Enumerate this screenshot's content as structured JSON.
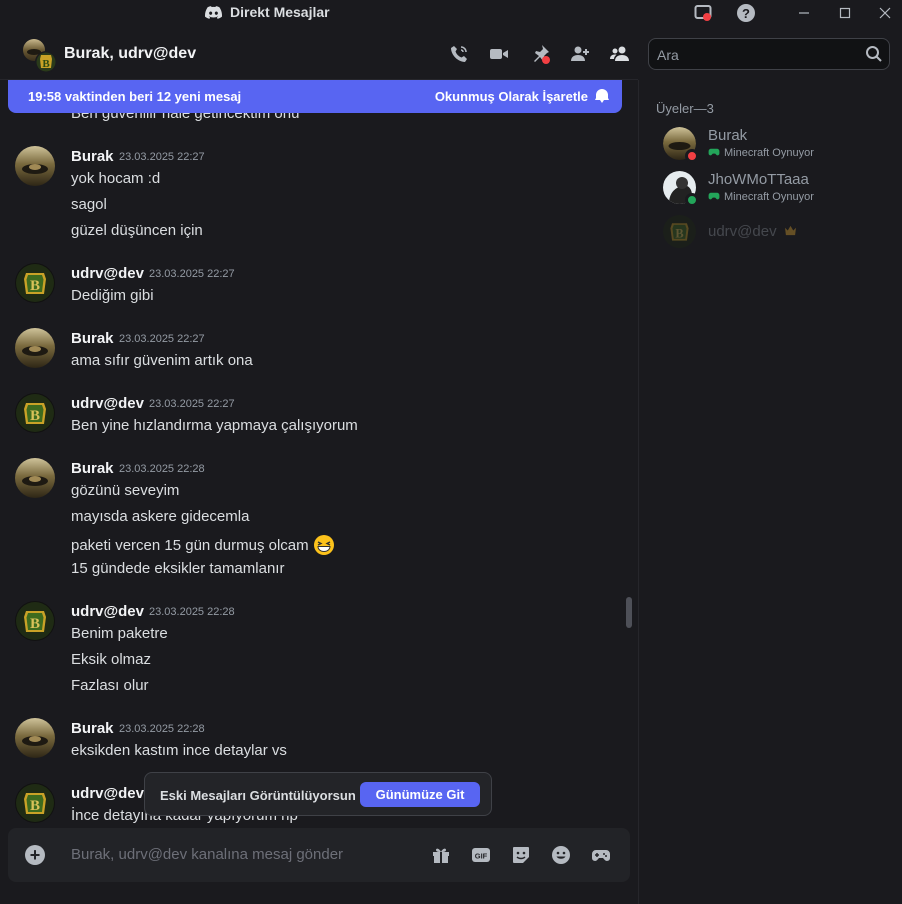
{
  "window": {
    "title": "Direkt Mesajlar"
  },
  "header": {
    "title": "Burak, udrv@dev",
    "search_placeholder": "Ara"
  },
  "banner": {
    "text": "19:58 vaktinden beri 12 yeni mesaj",
    "action": "Okunmuş Olarak İşaretle"
  },
  "chat": {
    "cut_off_line": "Ben güvenilir hale getiricektim onu",
    "messages": [
      {
        "author": "Burak",
        "timestamp": "23.03.2025 22:27",
        "lines": [
          "yok hocam :d",
          "sagol",
          "güzel düşüncen için"
        ]
      },
      {
        "author": "udrv@dev",
        "timestamp": "23.03.2025 22:27",
        "lines": [
          "Dediğim gibi"
        ]
      },
      {
        "author": "Burak",
        "timestamp": "23.03.2025 22:27",
        "lines": [
          "ama sıfır güvenim artık ona"
        ]
      },
      {
        "author": "udrv@dev",
        "timestamp": "23.03.2025 22:27",
        "lines": [
          "Ben yine hızlandırma yapmaya çalışıyorum"
        ]
      },
      {
        "author": "Burak",
        "timestamp": "23.03.2025 22:28",
        "lines": [
          "gözünü seveyim",
          "mayısda askere gidecemla",
          "paketi vercen 15 gün durmuş olcam",
          "15 gündede eksikler tamamlanır"
        ]
      },
      {
        "author": "udrv@dev",
        "timestamp": "23.03.2025 22:28",
        "lines": [
          "Benim paketre",
          "Eksik olmaz",
          "Fazlası olur"
        ]
      },
      {
        "author": "Burak",
        "timestamp": "23.03.2025 22:28",
        "lines": [
          "eksikden kastım ince detaylar vs"
        ]
      },
      {
        "author": "udrv@dev",
        "timestamp": "",
        "lines": [
          "İnce detayına kadar yapıyorum rip"
        ]
      }
    ]
  },
  "jump_bar": {
    "label": "Eski Mesajları Görüntülüyorsun",
    "button": "Günümüze Git"
  },
  "composer": {
    "placeholder": "Burak, udrv@dev kanalına mesaj gönder"
  },
  "members": {
    "heading": "Üyeler—3",
    "list": [
      {
        "name": "Burak",
        "activity": "Minecraft Oynuyor",
        "status_color": "#f23f43"
      },
      {
        "name": "JhoWMoTTaaa",
        "activity": "Minecraft Oynuyor",
        "status_color": "#23a55a"
      },
      {
        "name": "udrv@dev",
        "activity": "",
        "status_color": ""
      }
    ]
  },
  "colors": {
    "accent": "#5865f2",
    "online": "#23a55a",
    "dnd": "#f23f43"
  }
}
